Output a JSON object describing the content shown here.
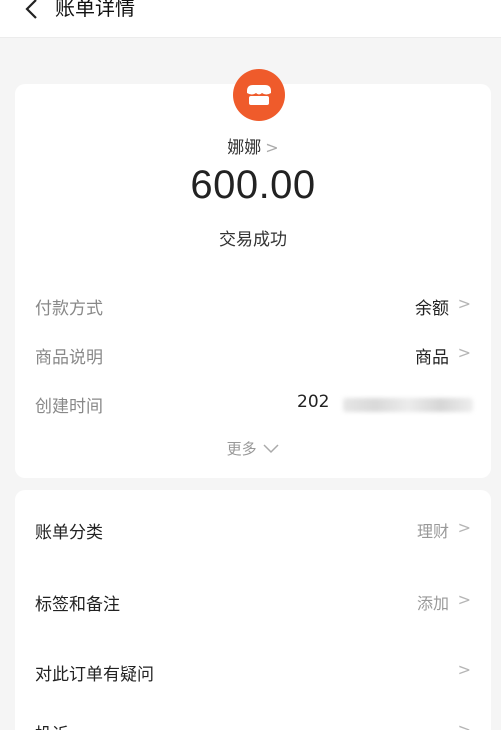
{
  "nav": {
    "title": "账单详情"
  },
  "summary": {
    "merchant": "娜娜",
    "amount": "600.00",
    "status": "交易成功"
  },
  "details": [
    {
      "label": "付款方式",
      "value": "余额"
    },
    {
      "label": "商品说明",
      "value": "商品"
    },
    {
      "label": "创建时间",
      "value": "202"
    }
  ],
  "more_label": "更多",
  "actions": [
    {
      "label": "账单分类",
      "value": "理财"
    },
    {
      "label": "标签和备注",
      "value": "添加"
    },
    {
      "label": "对此订单有疑问",
      "value": ""
    },
    {
      "label": "投诉",
      "value": ""
    }
  ],
  "colors": {
    "accent": "#ef5b2b",
    "background": "#f5f5f5"
  }
}
